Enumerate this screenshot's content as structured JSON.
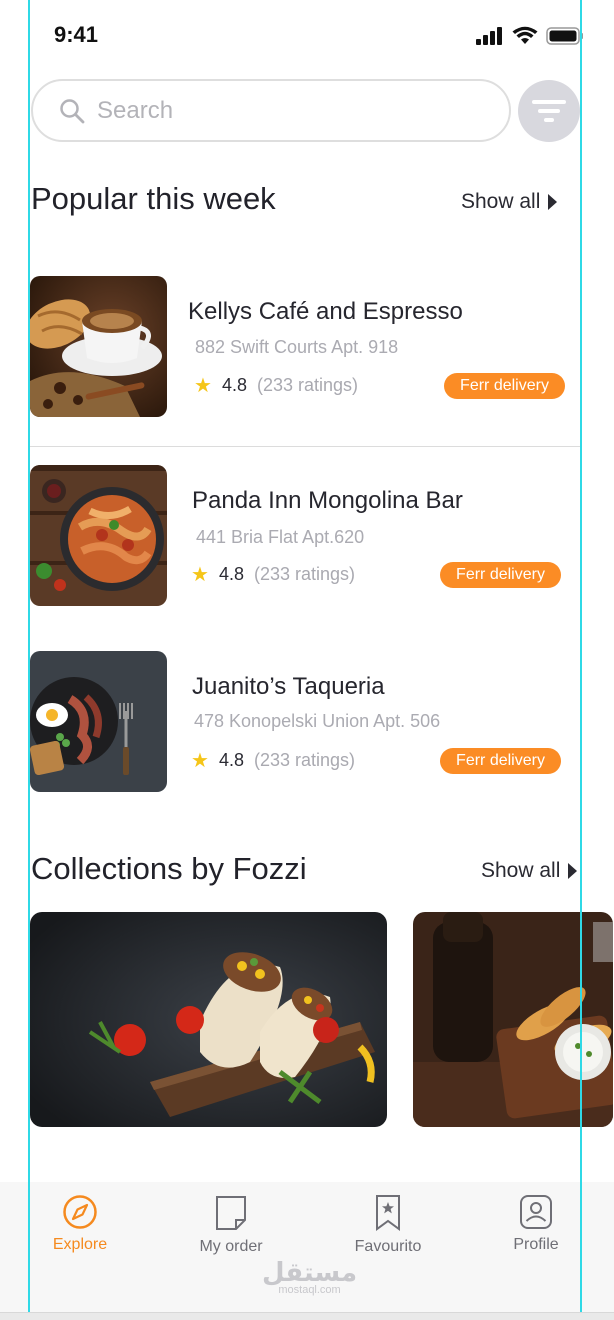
{
  "status_bar": {
    "time": "9:41"
  },
  "search": {
    "placeholder": "Search"
  },
  "popular": {
    "title": "Popular this week",
    "show_all": "Show all",
    "restaurants": [
      {
        "name": "Kellys Café  and  Espresso",
        "address": "882 Swift Courts Apt. 918",
        "rating": "4.8",
        "ratings_count": "(233 ratings)",
        "badge": "Ferr delivery"
      },
      {
        "name": "Panda Inn Mongolina Bar",
        "address": "441 Bria Flat Apt.620",
        "rating": "4.8",
        "ratings_count": "(233 ratings)",
        "badge": "Ferr delivery"
      },
      {
        "name": "Juanito’s Taqueria",
        "address": "478 Konopelski Union Apt. 506",
        "rating": "4.8",
        "ratings_count": "(233 ratings)",
        "badge": "Ferr delivery"
      }
    ]
  },
  "collections": {
    "title": "Collections by Fozzi",
    "show_all": "Show all"
  },
  "tabbar": {
    "tabs": [
      {
        "label": "Explore",
        "icon": "compass-icon",
        "active": true
      },
      {
        "label": "My order",
        "icon": "document-icon",
        "active": false
      },
      {
        "label": "Favourito",
        "icon": "bookmark-star-icon",
        "active": false
      },
      {
        "label": "Profile",
        "icon": "user-icon",
        "active": false
      }
    ]
  },
  "watermark": {
    "arabic": "مستقل",
    "latin": "mostaql.com"
  },
  "colors": {
    "accent": "#fb8c25",
    "active_tab": "#f58a1f",
    "star": "#f5c518",
    "guide": "#2fd9e6"
  }
}
